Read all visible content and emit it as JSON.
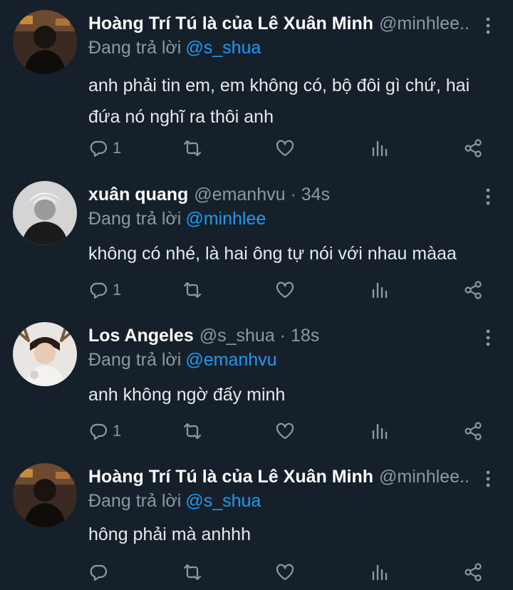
{
  "replying_label": "Đang trả lời",
  "colors": {
    "background": "#15202b",
    "secondary_text": "#8b98a5",
    "mention": "#1d9bf0",
    "primary_text": "#e7e9ea"
  },
  "tweets": [
    {
      "name": "Hoàng Trí Tú là của Lê Xuân Minh",
      "handle": "@minhlee...",
      "time": "",
      "replying_to": "@s_shua",
      "text": "anh phải tin em, em không có, bộ đôi gì chứ, hai đứa nó nghĩ ra thôi anh",
      "reply_count": "1",
      "avatar": "avatar-dark-portrait"
    },
    {
      "name": "xuân quang",
      "handle": "@emanhvu",
      "time": "34s",
      "replying_to": "@minhlee",
      "text": "không có nhé, là hai ông tự nói với nhau màaa",
      "reply_count": "1",
      "avatar": "avatar-grayscale-portrait"
    },
    {
      "name": "Los Angeles",
      "handle": "@s_shua",
      "time": "18s",
      "replying_to": "@emanhvu",
      "text": "anh không ngờ đấy minh",
      "reply_count": "1",
      "avatar": "avatar-antler-headband"
    },
    {
      "name": "Hoàng Trí Tú là của Lê Xuân Minh",
      "handle": "@minhlee...",
      "time": "",
      "replying_to": "@s_shua",
      "text": "hông phải mà anhhh",
      "reply_count": "",
      "avatar": "avatar-dark-portrait"
    }
  ],
  "icons": [
    "reply-icon",
    "retweet-icon",
    "like-icon",
    "analytics-icon",
    "share-icon",
    "more-options-icon"
  ]
}
